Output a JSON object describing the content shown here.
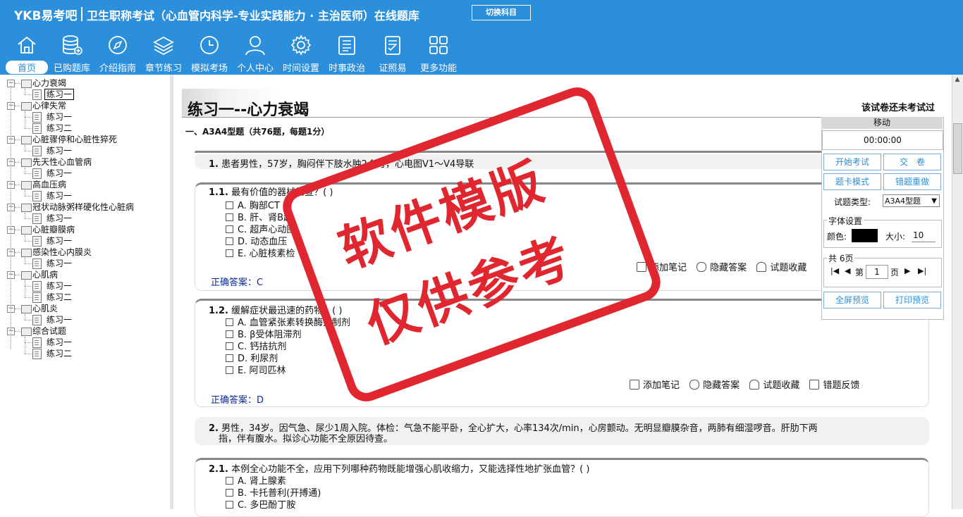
{
  "header": {
    "brand": "YKB易考吧",
    "title": "卫生职称考试（心血管内科学-专业实践能力 · 主治医师）在线题库",
    "switch_label": "切换科目"
  },
  "nav": [
    {
      "label": "首页",
      "icon": "home-icon"
    },
    {
      "label": "已购题库",
      "icon": "database-icon"
    },
    {
      "label": "介绍指南",
      "icon": "compass-icon"
    },
    {
      "label": "章节练习",
      "icon": "layers-icon"
    },
    {
      "label": "模拟考场",
      "icon": "clock-icon"
    },
    {
      "label": "个人中心",
      "icon": "user-icon"
    },
    {
      "label": "时间设置",
      "icon": "gear-icon"
    },
    {
      "label": "时事政治",
      "icon": "news-icon"
    },
    {
      "label": "证照易",
      "icon": "certificate-icon"
    },
    {
      "label": "更多功能",
      "icon": "grid-icon"
    }
  ],
  "tree": [
    {
      "label": "心力衰竭",
      "children": [
        "练习一"
      ]
    },
    {
      "label": "心律失常",
      "children": [
        "练习一",
        "练习二"
      ]
    },
    {
      "label": "心脏骤停和心脏性猝死",
      "children": [
        "练习一"
      ]
    },
    {
      "label": "先天性心血管病",
      "children": [
        "练习一"
      ]
    },
    {
      "label": "高血压病",
      "children": [
        "练习一"
      ]
    },
    {
      "label": "冠状动脉粥样硬化性心脏病",
      "children": [
        "练习一"
      ]
    },
    {
      "label": "心脏瓣膜病",
      "children": [
        "练习一"
      ]
    },
    {
      "label": "感染性心内膜炎",
      "children": [
        "练习一"
      ]
    },
    {
      "label": "心肌病",
      "children": [
        "练习一",
        "练习二"
      ]
    },
    {
      "label": "心肌炎",
      "children": [
        "练习一"
      ]
    },
    {
      "label": "综合试题",
      "children": [
        "练习一",
        "练习二"
      ]
    }
  ],
  "main": {
    "page_title": "练习一--心力衰竭",
    "not_taken": "该试卷还未考试过",
    "section_head": "一、A3A4型题（共76题，每题1分）",
    "q1_stem_num": "1.",
    "q1_stem": "患者男性，57岁，胸闷伴下肢水肿2个月，心电图V1～V4导联",
    "q11_num": "1.1.",
    "q11_text": "最有价值的器械检查？( )",
    "q11_opts": [
      "A. 胸部CT",
      "B. 肝、肾B超",
      "C. 超声心动图",
      "D. 动态血压",
      "E. 心脏核素检"
    ],
    "q11_answer": "正确答案：C",
    "q12_num": "1.2.",
    "q12_text": "缓解症状最迅速的药物？( )",
    "q12_opts": [
      "A. 血管紧张素转换酶抑制剂",
      "B. β受体阻滞剂",
      "C. 钙拮抗剂",
      "D. 利尿剂",
      "E. 阿司匹林"
    ],
    "q12_answer": "正确答案：D",
    "q2_stem_num": "2.",
    "q2_stem_line1": "男性，34岁。因气急、尿少1周入院。体检：气急不能平卧，全心扩大，心率134次/min，心房颤动。无明显瓣膜杂音，两肺有细湿啰音。肝肋下两",
    "q2_stem_line2": "指，伴有腹水。拟诊心功能不全原因待查。",
    "q21_num": "2.1.",
    "q21_text": "本例全心功能不全，应用下列哪种药物既能增强心肌收缩力，又能选择性地扩张血管？( )",
    "q21_opts": [
      "A. 肾上腺素",
      "B. 卡托普利(开搏通)",
      "C. 多巴酚丁胺"
    ],
    "actions": {
      "note": "添加笔记",
      "hide": "隐藏答案",
      "fav": "试题收藏",
      "feedback": "错题反馈"
    }
  },
  "panel": {
    "move": "移动",
    "timer": "00:00:00",
    "start": "开始考试",
    "submit": "交　卷",
    "card_mode": "题卡模式",
    "redo": "错题重做",
    "type_label": "试题类型:",
    "type_value": "A3A4型题",
    "font_legend": "字体设置",
    "color_label": "颜色:",
    "size_label": "大小:",
    "size_value": "10",
    "color_value": "#000000",
    "pages_legend": "共 6页",
    "page_prefix": "第",
    "page_value": "1",
    "page_suffix": "页",
    "fullscreen": "全屏预览",
    "print": "打印预览"
  },
  "watermark": {
    "line1": "软件模版",
    "line2": "仅供参考"
  }
}
